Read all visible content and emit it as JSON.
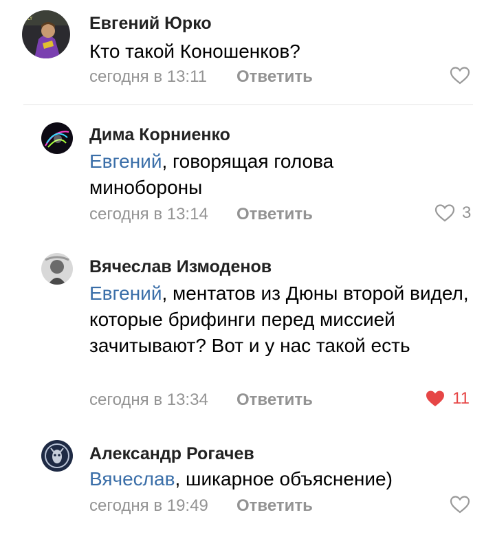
{
  "comments": [
    {
      "author": "Евгений Юрко",
      "mention": "",
      "text": "Кто такой Коношенков?",
      "time": "сегодня в 13:11",
      "reply_label": "Ответить",
      "likes": "",
      "liked": false
    },
    {
      "author": "Дима Корниенко",
      "mention": "Евгений",
      "text": ", говорящая голова минобороны",
      "time": "сегодня в 13:14",
      "reply_label": "Ответить",
      "likes": "3",
      "liked": false
    },
    {
      "author": "Вячеслав Измоденов",
      "mention": "Евгений",
      "text": ", ментатов из Дюны второй видел, которые брифинги перед миссией зачитывают? Вот и у нас такой есть",
      "time": "сегодня в 13:34",
      "reply_label": "Ответить",
      "likes": "11",
      "liked": true
    },
    {
      "author": "Александр Рогачев",
      "mention": "Вячеслав",
      "text": ", шикарное объяснение)",
      "time": "сегодня в 19:49",
      "reply_label": "Ответить",
      "likes": "",
      "liked": false
    }
  ],
  "icons": {
    "like": "heart-outline-icon",
    "liked": "heart-filled-icon"
  },
  "colors": {
    "mention": "#3a6ea8",
    "muted": "#939393",
    "liked": "#e64646"
  }
}
